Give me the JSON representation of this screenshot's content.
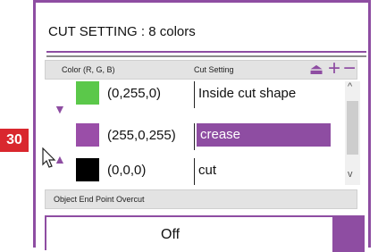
{
  "callout": {
    "number": "30",
    "color": "#d9272e"
  },
  "panel": {
    "title": "CUT SETTING : 8 colors",
    "accent": "#8e4da2",
    "header": {
      "col_color": "Color (R, G, B)",
      "col_cut": "Cut Setting"
    },
    "rows": [
      {
        "rgb": "(0,255,0)",
        "color": "#5bc84a",
        "cut": "Inside cut shape",
        "selected": false
      },
      {
        "rgb": "(255,0,255)",
        "color": "#9a4ea8",
        "cut": "crease",
        "selected": true
      },
      {
        "rgb": "(0,0,0)",
        "color": "#000000",
        "cut": "cut",
        "selected": false
      }
    ],
    "overcut": {
      "label": "Object End Point Overcut",
      "value": "Off"
    }
  }
}
